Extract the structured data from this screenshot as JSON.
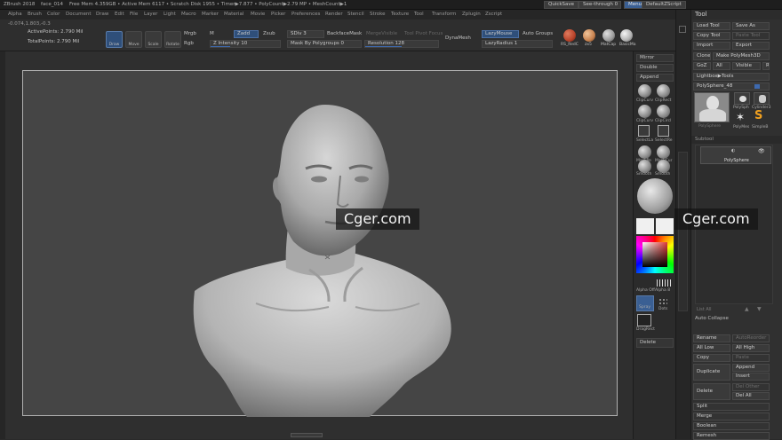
{
  "title_bar": {
    "app": "ZBrush 2018",
    "file": "face_014",
    "stats": "Free Mem 4.359GB • Active Mem 6117 • Scratch Disk 1955 • Timer▶7.877 • PolyCount▶2.79 MP • MeshCount▶1",
    "quicksave": "QuickSave",
    "see_through": "See-through 0",
    "menus_btn": "Menus",
    "script": "DefaultZScript"
  },
  "menubar": [
    "Alpha",
    "Brush",
    "Color",
    "Document",
    "Draw",
    "Edit",
    "File",
    "Layer",
    "Light",
    "Macro",
    "Marker",
    "Material",
    "Movie",
    "Picker",
    "Preferences",
    "Render",
    "Stencil",
    "Stroke",
    "Texture",
    "Tool",
    "Transform",
    "Zplugin",
    "Zscript"
  ],
  "shelf": {
    "coords": "-0.074,1.803,-0.3",
    "active_points": "ActivePoints: 2.790 Mil",
    "total_points": "TotalPoints: 2.790 Mil",
    "tools": [
      "Draw",
      "Move",
      "Scale",
      "Rotate"
    ],
    "mrgb": "Mrgb",
    "rgb": "Rgb",
    "m": "M",
    "zadd": "Zadd",
    "zsub": "Zsub",
    "z_intensity": "Z Intensity 10",
    "sdiv": "SDiv 3",
    "backface_mask": "BackfaceMask",
    "merge_visible": "MergeVisible",
    "pivot_focus": "Tool Pivot Focus",
    "mask_by_polygroups": "Mask By Polygroups 0",
    "resolution": "Resolution 128",
    "dynamesh": "DynaMesh",
    "lazymouse": "LazyMouse",
    "auto_groups": "Auto Groups",
    "lazyradius": "LazyRadius 1",
    "materials": [
      "RS_RedC",
      "zx5",
      "MatCap",
      "BasicMa"
    ],
    "material_colors": [
      "#b8432a",
      "#c8824f",
      "#9a9a9a",
      "#b0b0b0"
    ]
  },
  "right_shelf": {
    "mirror": "Mirror",
    "double": "Double",
    "append": "Append",
    "icons1": [
      "ClipCurv",
      "ClipRect"
    ],
    "icons2": [
      "ClipCurv",
      "ClipCircl"
    ],
    "icons3": [
      "SelectLa",
      "SelectRe"
    ],
    "icons4": [
      "MaskPe",
      "MaskCur"
    ],
    "icons5": [
      "Smooth",
      "Smooth"
    ],
    "alpha_off": "Alpha Off",
    "alpha_b": "Alpha 8",
    "spray": "Spray",
    "dots": "Dots",
    "dragrect": "DragRect",
    "delete": "Delete"
  },
  "tool_panel": {
    "title": "Tool",
    "load_tool": "Load Tool",
    "save_as": "Save As",
    "copy_tool": "Copy Tool",
    "paste_tool": "Paste Tool",
    "import": "Import",
    "export": "Export",
    "clone": "Clone",
    "make_polymesh": "Make PolyMesh3D",
    "goz": "GoZ",
    "all": "All",
    "visible": "Visible",
    "r": "R",
    "lightbox": "Lightbox▶Tools",
    "current_tool": "PolySphere_48",
    "thumbs": [
      "PolySphere",
      "PolySph",
      "Cylinder3",
      "PolyMes",
      "SimpleB"
    ],
    "subtool_header": "Subtool",
    "subtool_item": "PolySphere",
    "list_all": "List All",
    "auto_collapse": "Auto Collapse",
    "rename": "Rename",
    "autoreorder": "AutoReorder",
    "all_low": "All Low",
    "all_high": "All High",
    "copy": "Copy",
    "paste": "Paste",
    "duplicate": "Duplicate",
    "append": "Append",
    "insert": "Insert",
    "delete": "Delete",
    "del_other": "Del Other",
    "del_all": "Del All",
    "split": "Split",
    "merge": "Merge",
    "boolean": "Boolean",
    "remesh": "Remesh"
  },
  "watermark": "Cger.com"
}
